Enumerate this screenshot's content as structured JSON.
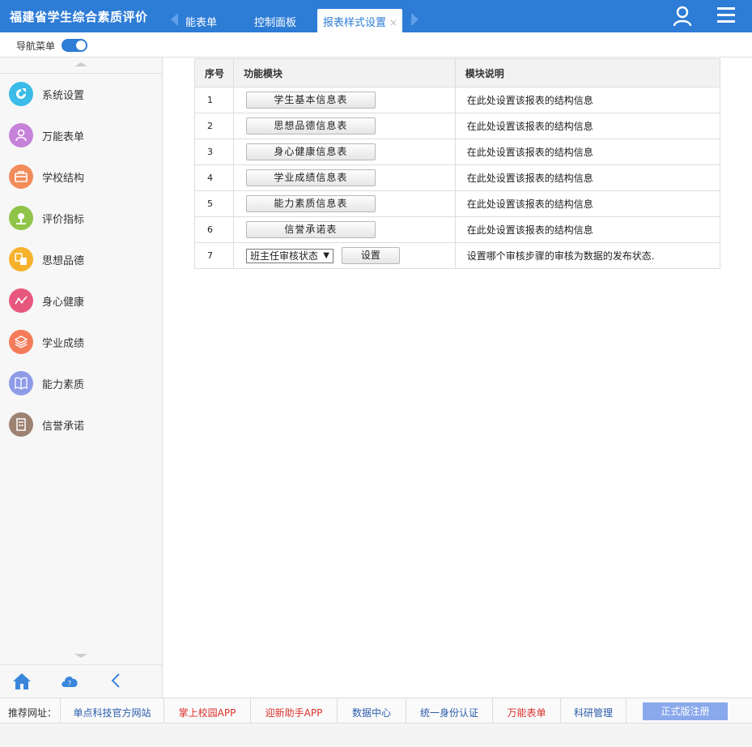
{
  "app": {
    "title": "福建省学生综合素质评价",
    "brand_color": "#2d7cd6"
  },
  "tabs": [
    {
      "label": "能表单",
      "active": false
    },
    {
      "label": "控制面板",
      "active": false
    },
    {
      "label": "报表样式设置",
      "active": true,
      "close": "×"
    }
  ],
  "header_icons": [
    "user-icon",
    "menu-icon"
  ],
  "navbar": {
    "toggle_label": "导航菜单",
    "toggle_on": true
  },
  "sidebar": {
    "items": [
      {
        "label": "系统设置",
        "icon": "settings-icon",
        "color": "#3bbbe8"
      },
      {
        "label": "万能表单",
        "icon": "user-form-icon",
        "color": "#c682d9"
      },
      {
        "label": "学校结构",
        "icon": "briefcase-icon",
        "color": "#f28c5a"
      },
      {
        "label": "评价指标",
        "icon": "location-pin-icon",
        "color": "#8fc449"
      },
      {
        "label": "思想品德",
        "icon": "transfer-icon",
        "color": "#f7b22c"
      },
      {
        "label": "身心健康",
        "icon": "chart-line-icon",
        "color": "#e8587e"
      },
      {
        "label": "学业成绩",
        "icon": "layers-icon",
        "color": "#f47b5a"
      },
      {
        "label": "能力素质",
        "icon": "book-icon",
        "color": "#8e9ce8"
      },
      {
        "label": "信誉承诺",
        "icon": "building-icon",
        "color": "#9d8272"
      }
    ],
    "bottom_icons": [
      "home-icon",
      "cloud-help-icon",
      "collapse-left-icon"
    ]
  },
  "table": {
    "headers": [
      "序号",
      "功能模块",
      "模块说明"
    ],
    "rows": [
      {
        "num": "1",
        "button": "学生基本信息表",
        "desc": "在此处设置该报表的结构信息"
      },
      {
        "num": "2",
        "button": "思想品德信息表",
        "desc": "在此处设置该报表的结构信息"
      },
      {
        "num": "3",
        "button": "身心健康信息表",
        "desc": "在此处设置该报表的结构信息"
      },
      {
        "num": "4",
        "button": "学业成绩信息表",
        "desc": "在此处设置该报表的结构信息"
      },
      {
        "num": "5",
        "button": "能力素质信息表",
        "desc": "在此处设置该报表的结构信息"
      },
      {
        "num": "6",
        "button": "信誉承诺表",
        "desc": "在此处设置该报表的结构信息"
      }
    ],
    "last_row": {
      "num": "7",
      "select_value": "班主任审核状态",
      "set_label": "设置",
      "desc": "设置哪个审核步骤的审核为数据的发布状态."
    }
  },
  "footer": {
    "label": "推荐网址：",
    "links": [
      {
        "label": "单点科技官方网站",
        "color": "#2a5caa"
      },
      {
        "label": "掌上校园APP",
        "color": "#d9302c"
      },
      {
        "label": "迎新助手APP",
        "color": "#d9302c"
      },
      {
        "label": "数据中心",
        "color": "#2a5caa"
      },
      {
        "label": "统一身份认证",
        "color": "#2a5caa"
      },
      {
        "label": "万能表单",
        "color": "#d9302c"
      },
      {
        "label": "科研管理",
        "color": "#2a5caa"
      }
    ],
    "register_label": "正式版注册"
  }
}
